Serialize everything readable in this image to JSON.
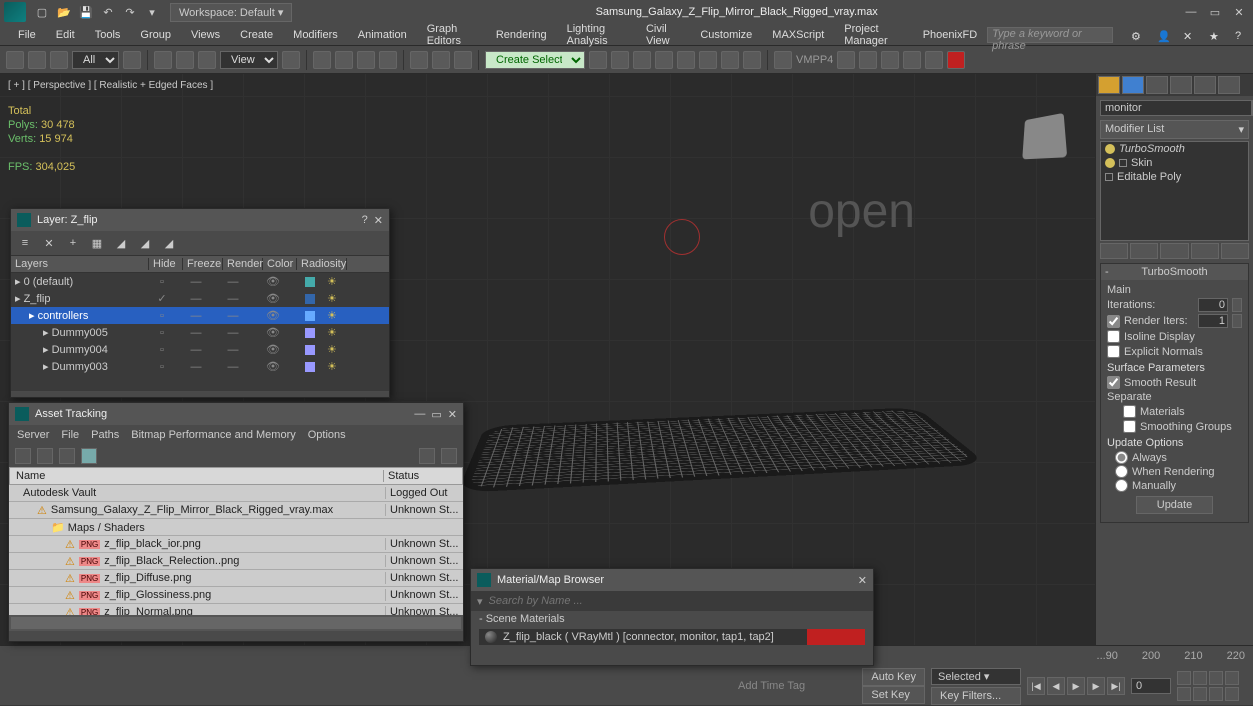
{
  "titlebar": {
    "workspace": "Workspace: Default",
    "title": "Samsung_Galaxy_Z_Flip_Mirror_Black_Rigged_vray.max",
    "logo_label": "MXD"
  },
  "menus": [
    "File",
    "Edit",
    "Tools",
    "Group",
    "Views",
    "Create",
    "Modifiers",
    "Animation",
    "Graph Editors",
    "Rendering",
    "Lighting Analysis",
    "Civil View",
    "Customize",
    "MAXScript",
    "Project Manager",
    "PhoenixFD"
  ],
  "search_placeholder": "Type a keyword or phrase",
  "toolbar": {
    "all": "All",
    "view": "View",
    "create_set": "Create Selection Se",
    "vmpp": "VMPP4"
  },
  "viewport": {
    "label": "[ + ] [ Perspective ] [ Realistic + Edged Faces ]",
    "total": "Total",
    "polys_l": "Polys:",
    "polys_v": "30 478",
    "verts_l": "Verts:",
    "verts_v": "15 974",
    "fps_l": "FPS:",
    "fps_v": "304,025",
    "open": "open"
  },
  "modpanel": {
    "objname": "monitor",
    "modlist": "Modifier List",
    "stack": [
      "TurboSmooth",
      "Skin",
      "Editable Poly"
    ],
    "rollout_title": "TurboSmooth",
    "main": "Main",
    "iterations_l": "Iterations:",
    "iterations_v": "0",
    "renderiters_l": "Render Iters:",
    "renderiters_v": "1",
    "isoline": "Isoline Display",
    "explicit": "Explicit Normals",
    "surface": "Surface Parameters",
    "smooth": "Smooth Result",
    "separate": "Separate",
    "materials": "Materials",
    "smgroups": "Smoothing Groups",
    "update": "Update Options",
    "always": "Always",
    "when": "When Rendering",
    "manual": "Manually",
    "updatebtn": "Update"
  },
  "layerwin": {
    "title": "Layer: Z_flip",
    "cols": {
      "layers": "Layers",
      "hide": "Hide",
      "freeze": "Freeze",
      "render": "Render",
      "color": "Color",
      "radio": "Radiosity"
    },
    "rows": [
      {
        "name": "0 (default)",
        "indent": 0,
        "color": "#4aa"
      },
      {
        "name": "Z_flip",
        "indent": 0,
        "color": "#36a",
        "check": true
      },
      {
        "name": "controllers",
        "indent": 1,
        "color": "#6af",
        "sel": true
      },
      {
        "name": "Dummy005",
        "indent": 2,
        "color": "#99f"
      },
      {
        "name": "Dummy004",
        "indent": 2,
        "color": "#99f"
      },
      {
        "name": "Dummy003",
        "indent": 2,
        "color": "#99f"
      }
    ]
  },
  "assetwin": {
    "title": "Asset Tracking",
    "menus": [
      "Server",
      "File",
      "Paths",
      "Bitmap Performance and Memory",
      "Options"
    ],
    "cols": {
      "name": "Name",
      "status": "Status"
    },
    "rows": [
      {
        "name": "Autodesk Vault",
        "status": "Logged Out",
        "indent": 1
      },
      {
        "name": "Samsung_Galaxy_Z_Flip_Mirror_Black_Rigged_vray.max",
        "status": "Unknown St...",
        "indent": 2,
        "warn": true
      },
      {
        "name": "Maps / Shaders",
        "status": "",
        "indent": 3,
        "folder": true
      },
      {
        "name": "z_flip_black_ior.png",
        "status": "Unknown St...",
        "indent": 4,
        "warn": true,
        "png": true
      },
      {
        "name": "z_flip_Black_Relection..png",
        "status": "Unknown St...",
        "indent": 4,
        "warn": true,
        "png": true
      },
      {
        "name": "z_flip_Diffuse.png",
        "status": "Unknown St...",
        "indent": 4,
        "warn": true,
        "png": true
      },
      {
        "name": "z_flip_Glossiness.png",
        "status": "Unknown St...",
        "indent": 4,
        "warn": true,
        "png": true
      },
      {
        "name": "z_flip_Normal.png",
        "status": "Unknown St...",
        "indent": 4,
        "warn": true,
        "png": true
      }
    ]
  },
  "matwin": {
    "title": "Material/Map Browser",
    "search": "Search by Name ...",
    "cat": "- Scene Materials",
    "item": "Z_flip_black  ( VRayMtl )  [connector, monitor, tap1, tap2]"
  },
  "bottom": {
    "frames": [
      "...90",
      "200",
      "210",
      "220"
    ],
    "autokey": "Auto Key",
    "setkey": "Set Key",
    "selected": "Selected",
    "keyfilters": "Key Filters...",
    "frame": "0",
    "addtag": "Add Time Tag"
  }
}
